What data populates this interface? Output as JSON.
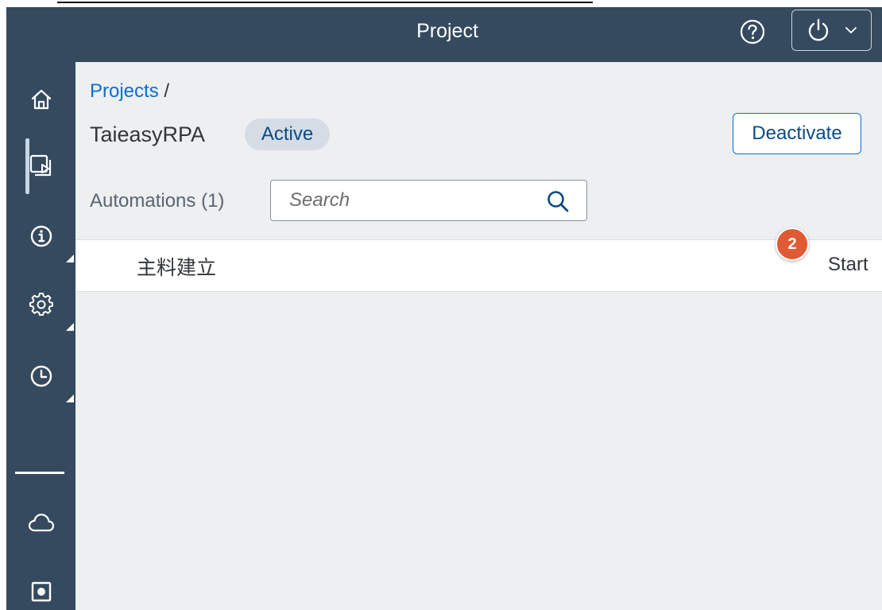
{
  "header": {
    "title": "Project",
    "help_icon": "help-circle-icon",
    "power_icon": "power-icon",
    "chevron_icon": "chevron-down-icon",
    "background_color": "#354a5f"
  },
  "sidebar": {
    "items": [
      {
        "name": "home",
        "icon": "home-icon"
      },
      {
        "name": "automations",
        "icon": "automation-play-icon",
        "active": true
      },
      {
        "name": "info",
        "icon": "info-icon"
      },
      {
        "name": "settings",
        "icon": "gear-icon"
      },
      {
        "name": "history",
        "icon": "clock-icon"
      },
      {
        "name": "cloud",
        "icon": "cloud-icon"
      },
      {
        "name": "record",
        "icon": "record-icon"
      }
    ]
  },
  "breadcrumb": {
    "link": "Projects",
    "separator": "/"
  },
  "project": {
    "name": "TaieasyRPA",
    "status": "Active",
    "deactivate_label": "Deactivate"
  },
  "automations": {
    "label": "Automations (1)",
    "search_placeholder": "Search",
    "items": [
      {
        "name": "主料建立",
        "action": "Start"
      }
    ]
  },
  "step_badge": "2",
  "colors": {
    "accent": "#0a6ed1",
    "badge": "#e05a33",
    "status_pill": "#d5dce5"
  }
}
